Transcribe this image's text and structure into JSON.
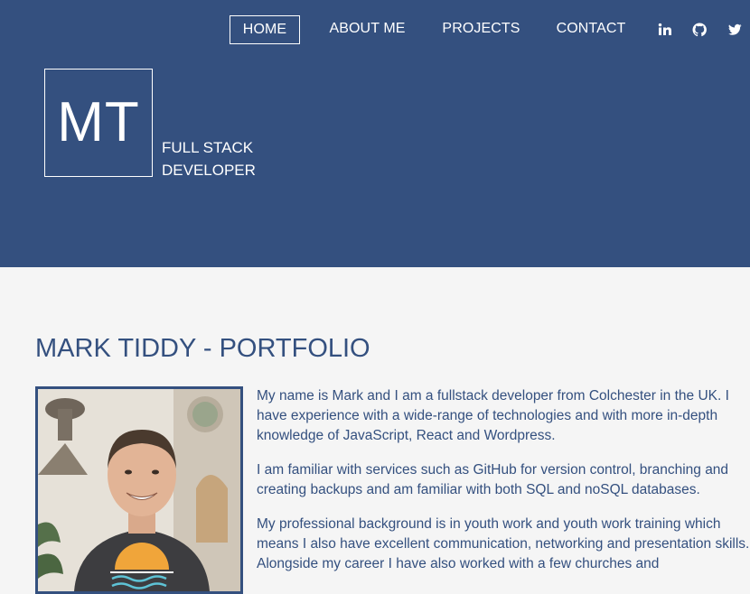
{
  "nav": {
    "items": [
      {
        "label": "HOME",
        "active": true
      },
      {
        "label": "ABOUT ME",
        "active": false
      },
      {
        "label": "PROJECTS",
        "active": false
      },
      {
        "label": "CONTACT",
        "active": false
      }
    ],
    "social_icons": [
      "linkedin-icon",
      "github-icon",
      "twitter-icon"
    ]
  },
  "logo": {
    "initials": "MT",
    "tagline_line1": "FULL STACK",
    "tagline_line2": "DEVELOPER"
  },
  "main": {
    "title": "MARK TIDDY - PORTFOLIO",
    "bio": [
      "My name is Mark and I am a fullstack developer from Colchester in the UK. I have experience with a wide-range of technologies and with more in-depth knowledge of JavaScript, React and Wordpress.",
      "I am familiar with services such as GitHub for version control, branching and creating backups and am familiar with both SQL and noSQL databases.",
      "My professional background is in youth work and youth work training which means I also have excellent communication, networking and presentation skills. Alongside my career I have also worked with a few churches and"
    ]
  },
  "colors": {
    "brand": "#34507f",
    "background": "#f5f5f5",
    "header_text": "#ffffff"
  }
}
